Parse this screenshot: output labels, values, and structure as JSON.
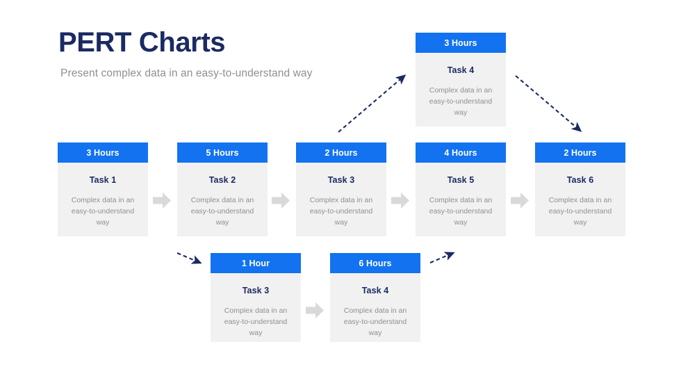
{
  "heading": {
    "title": "PERT Charts",
    "subtitle": "Present complex data in an easy-to-understand way"
  },
  "colors": {
    "title": "#1b2a62",
    "subtitle": "#8d8f92",
    "header_blue": "#1272f0",
    "card_body": "#f1f1f2",
    "task_text": "#1b2a62",
    "desc_text": "#8d8f92",
    "block_arrow": "#d9d9d9",
    "dashed_arrow": "#1b2a62"
  },
  "description_text": "Complex data in an easy-to-understand way",
  "cards": {
    "top": [
      {
        "id": "top-task4",
        "hours": "3 Hours",
        "task": "Task 4",
        "desc": "Complex data in an easy-to-understand way"
      }
    ],
    "middle": [
      {
        "id": "mid-task1",
        "hours": "3 Hours",
        "task": "Task 1",
        "desc": "Complex data in an easy-to-understand way"
      },
      {
        "id": "mid-task2",
        "hours": "5 Hours",
        "task": "Task 2",
        "desc": "Complex data in an easy-to-understand way"
      },
      {
        "id": "mid-task3",
        "hours": "2 Hours",
        "task": "Task 3",
        "desc": "Complex data in an easy-to-understand way"
      },
      {
        "id": "mid-task5",
        "hours": "4 Hours",
        "task": "Task 5",
        "desc": "Complex data in an easy-to-understand way"
      },
      {
        "id": "mid-task6",
        "hours": "2 Hours",
        "task": "Task 6",
        "desc": "Complex data in an easy-to-understand way"
      }
    ],
    "bottom": [
      {
        "id": "bot-task3",
        "hours": "1 Hour",
        "task": "Task 3",
        "desc": "Complex data in an easy-to-understand way"
      },
      {
        "id": "bot-task4",
        "hours": "6 Hours",
        "task": "Task 4",
        "desc": "Complex data in an easy-to-understand way"
      }
    ]
  },
  "connectors": {
    "block_arrows": [
      {
        "name": "arrow-task1-to-task2"
      },
      {
        "name": "arrow-task2-to-task3"
      },
      {
        "name": "arrow-task3-to-task5"
      },
      {
        "name": "arrow-task5-to-task6"
      },
      {
        "name": "arrow-bottom-task3-to-task4"
      }
    ],
    "dashed_arrows": [
      {
        "name": "dashed-arrow-up-to-top-task4"
      },
      {
        "name": "dashed-arrow-down-from-top-task4"
      },
      {
        "name": "dashed-arrow-down-to-bottom-task3"
      },
      {
        "name": "dashed-arrow-up-from-bottom-task4"
      }
    ]
  }
}
